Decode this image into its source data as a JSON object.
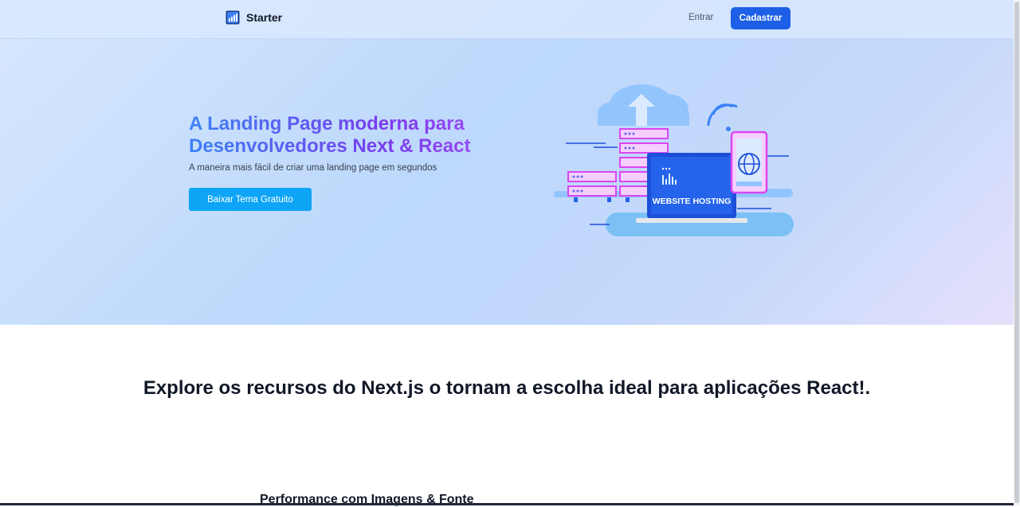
{
  "navbar": {
    "brand_name": "Starter",
    "brand_icon": "bar-chart-logo-icon",
    "login_label": "Entrar",
    "signup_label": "Cadastrar",
    "accent_color": "#1d5fe6"
  },
  "hero": {
    "title": "A Landing Page moderna para Desenvolvedores Next & React",
    "subtitle": "A maneira mais fácil de criar uma landing page em segundos",
    "cta_label": "Baixar Tema Gratuito",
    "cta_color": "#0ea5f6",
    "illustration": {
      "icon": "website-hosting-illustration",
      "label": "WEBSITE HOSTING"
    }
  },
  "features": {
    "title": "Explore os recursos do Next.js o tornam a escolha ideal para aplicações React!.",
    "first_feature_heading": "Performance com Imagens & Fonte"
  }
}
